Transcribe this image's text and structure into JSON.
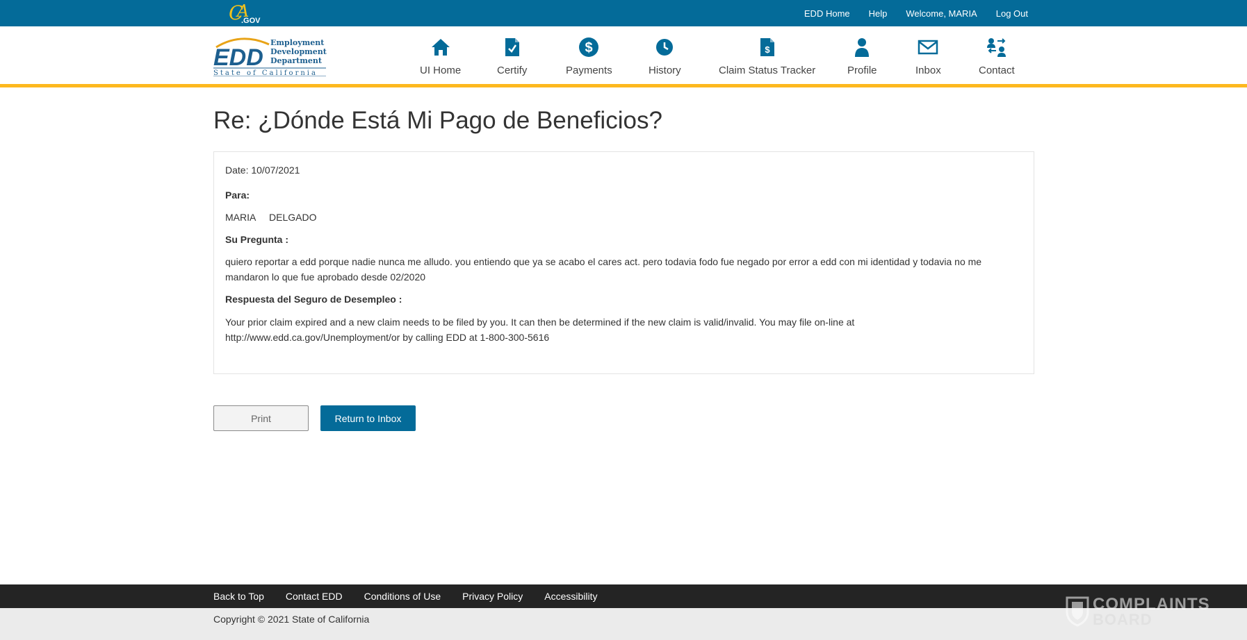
{
  "topbar": {
    "cagov_logo": "CA.GOV",
    "links": [
      "EDD Home",
      "Help",
      "Welcome, MARIA",
      "Log Out"
    ]
  },
  "header": {
    "logo": {
      "edd": "EDD",
      "line1": "Employment",
      "line2": "Development",
      "line3": "Department",
      "line4": "State of California"
    },
    "nav": [
      {
        "label": "UI Home",
        "icon": "home-icon"
      },
      {
        "label": "Certify",
        "icon": "certify-document-icon"
      },
      {
        "label": "Payments",
        "icon": "dollar-icon"
      },
      {
        "label": "History",
        "icon": "clock-icon"
      },
      {
        "label": "Claim Status Tracker",
        "icon": "claim-document-dollar-icon"
      },
      {
        "label": "Profile",
        "icon": "person-icon"
      },
      {
        "label": "Inbox",
        "icon": "envelope-icon"
      },
      {
        "label": "Contact",
        "icon": "contact-exchange-icon"
      }
    ]
  },
  "main": {
    "title": "Re: ¿Dónde Está Mi Pago de Beneficios?",
    "message": {
      "date": "Date: 10/07/2021",
      "to_label": "Para:",
      "to_name": "MARIA     DELGADO",
      "question_label": "Su Pregunta :",
      "question": "quiero reportar a edd porque nadie nunca me alludo. you entiendo que ya se acabo el cares act. pero todavia fodo fue negado por error a edd con mi identidad y todavia no me mandaron lo que fue aprobado desde 02/2020",
      "answer_label": "Respuesta del Seguro de Desempleo :",
      "answer": "Your prior claim expired and a new claim needs to be filed by you. It can then be determined if the new claim is valid/invalid. You may file on-line at http://www.edd.ca.gov/Unemployment/or by calling EDD at 1-800-300-5616"
    },
    "buttons": {
      "print": "Print",
      "return": "Return to Inbox"
    }
  },
  "footer": {
    "links": [
      "Back to Top",
      "Contact EDD",
      "Conditions of Use",
      "Privacy Policy",
      "Accessibility"
    ],
    "copyright": "Copyright © 2021 State of California"
  },
  "watermark": {
    "line1": "COMPLAINTS",
    "line2": "BOARD"
  },
  "colors": {
    "primary": "#046b99",
    "accent": "#fdb81e",
    "footer": "#242424"
  }
}
